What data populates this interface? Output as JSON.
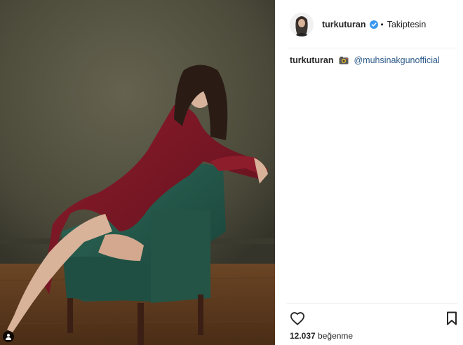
{
  "post": {
    "username": "turkuturan",
    "follow_status": "Takiptesin",
    "separator": "•",
    "verified_icon": "verified-badge-icon",
    "caption": {
      "username": "turkuturan",
      "emoji_icon": "camera-icon",
      "mention": "@muhsinakgunofficial"
    },
    "likes": {
      "count": "12.037",
      "label": "beğenme"
    },
    "colors": {
      "verified": "#3897f0",
      "mention": "#2d5b8a",
      "divider": "#efefef"
    }
  }
}
